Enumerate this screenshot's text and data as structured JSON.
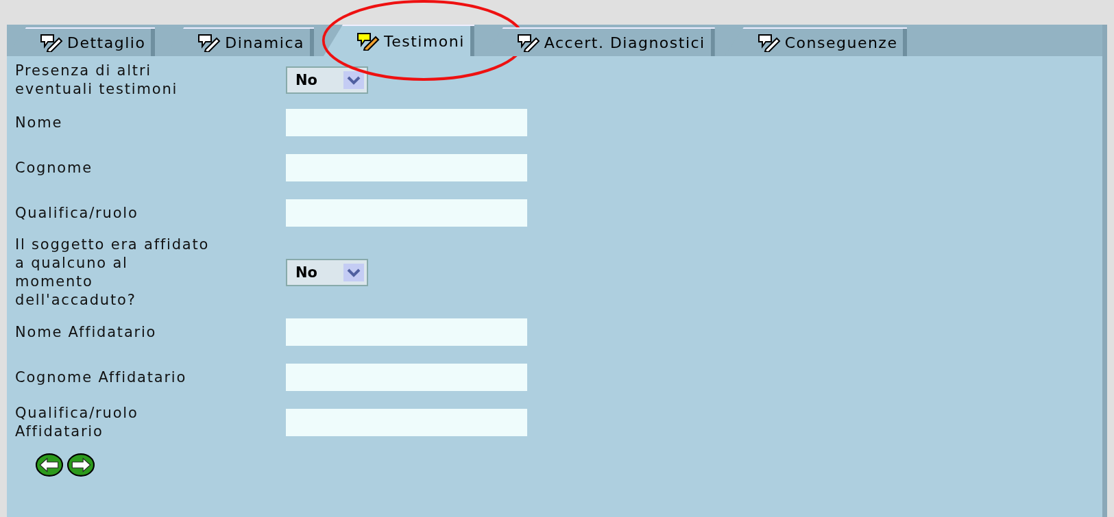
{
  "tabs": [
    {
      "label": "Dettaglio",
      "selected": false,
      "circled": false
    },
    {
      "label": "Dinamica",
      "selected": false,
      "circled": false
    },
    {
      "label": "Testimoni",
      "selected": true,
      "circled": true
    },
    {
      "label": "Accert. Diagnostici",
      "selected": false,
      "circled": false
    },
    {
      "label": "Conseguenze",
      "selected": false,
      "circled": false
    }
  ],
  "fields": [
    {
      "kind": "select",
      "label": "Presenza di altri\neventuali testimoni",
      "value": "No"
    },
    {
      "kind": "text",
      "label": "Nome"
    },
    {
      "kind": "text",
      "label": "Cognome"
    },
    {
      "kind": "text",
      "label": "Qualifica/ruolo"
    },
    {
      "kind": "select",
      "label": "Il soggetto era affidato\na qualcuno al\nmomento\ndell'accaduto?",
      "value": "No"
    },
    {
      "kind": "text",
      "label": "Nome Affidatario"
    },
    {
      "kind": "text",
      "label": "Cognome Affidatario"
    },
    {
      "kind": "text",
      "label": "Qualifica/ruolo\nAffidatario"
    }
  ],
  "nav": [
    {
      "kind": "back"
    },
    {
      "kind": "forward"
    }
  ]
}
